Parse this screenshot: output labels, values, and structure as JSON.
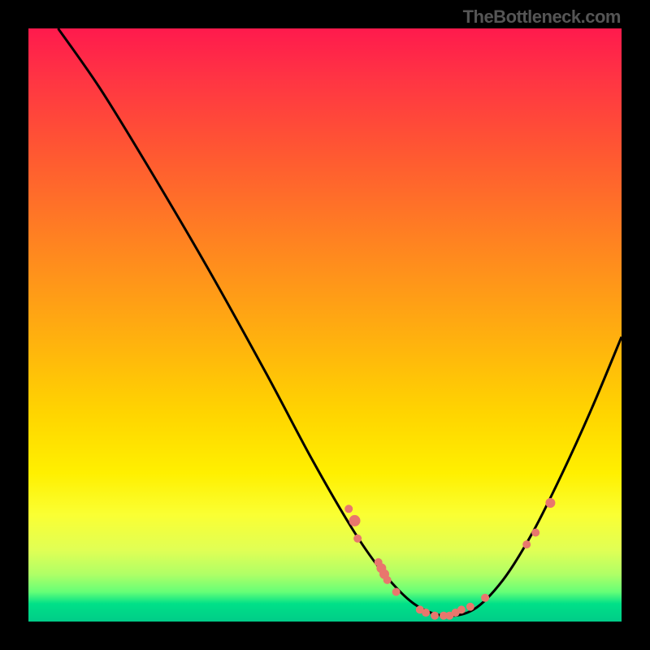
{
  "watermark": "TheBottleneck.com",
  "chart_data": {
    "type": "line",
    "title": "",
    "xlabel": "",
    "ylabel": "",
    "xlim": [
      0,
      100
    ],
    "ylim": [
      0,
      100
    ],
    "curve": [
      {
        "x": 5,
        "y": 100
      },
      {
        "x": 12,
        "y": 90
      },
      {
        "x": 20,
        "y": 77
      },
      {
        "x": 30,
        "y": 60
      },
      {
        "x": 40,
        "y": 42
      },
      {
        "x": 48,
        "y": 27
      },
      {
        "x": 55,
        "y": 15
      },
      {
        "x": 60,
        "y": 8
      },
      {
        "x": 65,
        "y": 3
      },
      {
        "x": 70,
        "y": 1
      },
      {
        "x": 75,
        "y": 2
      },
      {
        "x": 80,
        "y": 7
      },
      {
        "x": 85,
        "y": 15
      },
      {
        "x": 90,
        "y": 25
      },
      {
        "x": 95,
        "y": 36
      },
      {
        "x": 100,
        "y": 48
      }
    ],
    "dots": [
      {
        "x": 54,
        "y": 19,
        "r": 5
      },
      {
        "x": 55,
        "y": 17,
        "r": 7
      },
      {
        "x": 55.5,
        "y": 14,
        "r": 5
      },
      {
        "x": 59,
        "y": 10,
        "r": 5
      },
      {
        "x": 59.5,
        "y": 9,
        "r": 6
      },
      {
        "x": 60,
        "y": 8,
        "r": 6
      },
      {
        "x": 60.5,
        "y": 7,
        "r": 5
      },
      {
        "x": 62,
        "y": 5,
        "r": 5
      },
      {
        "x": 66,
        "y": 2,
        "r": 5
      },
      {
        "x": 67,
        "y": 1.5,
        "r": 5
      },
      {
        "x": 68.5,
        "y": 1,
        "r": 5
      },
      {
        "x": 70,
        "y": 1,
        "r": 5
      },
      {
        "x": 71,
        "y": 1,
        "r": 5
      },
      {
        "x": 72,
        "y": 1.5,
        "r": 5
      },
      {
        "x": 73,
        "y": 2,
        "r": 5
      },
      {
        "x": 74.5,
        "y": 2.5,
        "r": 5
      },
      {
        "x": 77,
        "y": 4,
        "r": 5
      },
      {
        "x": 84,
        "y": 13,
        "r": 5
      },
      {
        "x": 85.5,
        "y": 15,
        "r": 5
      },
      {
        "x": 88,
        "y": 20,
        "r": 6
      }
    ],
    "dot_color": "#e8776d",
    "curve_color": "#000000"
  }
}
